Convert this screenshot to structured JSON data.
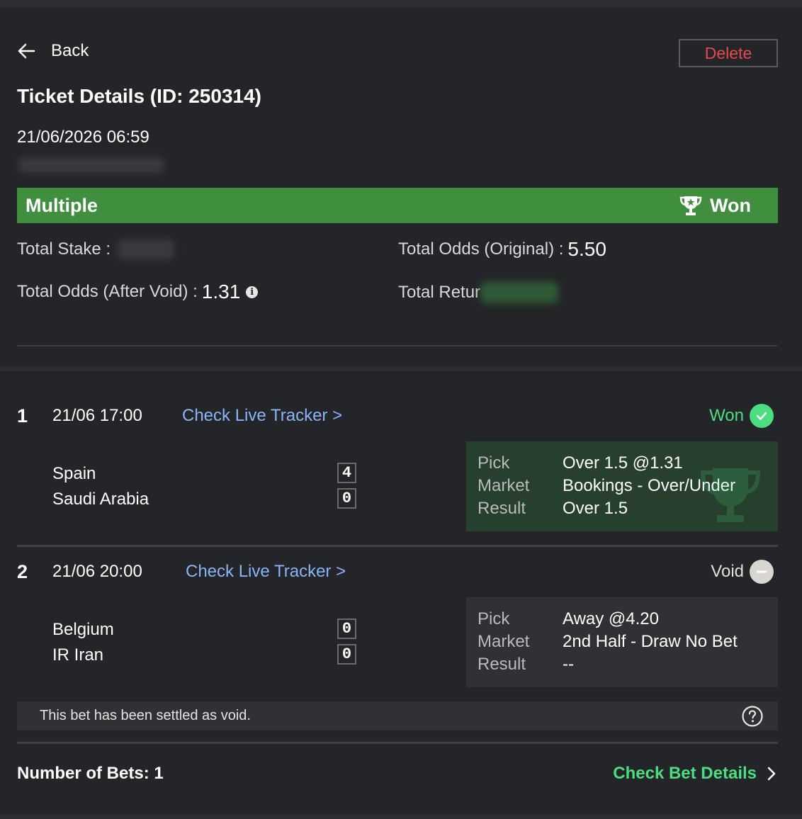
{
  "header": {
    "back_label": "Back",
    "delete_label": "Delete",
    "title": "Ticket Details (ID: 250314)",
    "datetime": "21/06/2026 06:59"
  },
  "status_bar": {
    "bet_type": "Multiple",
    "result": "Won",
    "color": "#3f8f3f"
  },
  "stats": {
    "total_stake_label": "Total Stake :",
    "total_odds_original_label": "Total Odds (Original) :",
    "total_odds_original_value": "5.50",
    "total_odds_after_void_label": "Total Odds (After Void) :",
    "total_odds_after_void_value": "1.31",
    "total_return_label": "Total Retur"
  },
  "legs": [
    {
      "number": "1",
      "time": "21/06 17:00",
      "tracker_label": "Check Live Tracker >",
      "status": "Won",
      "status_color": "#4ade80",
      "home": "Spain",
      "away": "Saudi Arabia",
      "home_score": "4",
      "away_score": "0",
      "pick_label": "Pick",
      "pick": "Over 1.5 @1.31",
      "market_label": "Market",
      "market": "Bookings - Over/Under",
      "result_label": "Result",
      "result": "Over 1.5"
    },
    {
      "number": "2",
      "time": "21/06 20:00",
      "tracker_label": "Check Live Tracker >",
      "status": "Void",
      "status_color": "#e0e0e0",
      "home": "Belgium",
      "away": "IR Iran",
      "home_score": "0",
      "away_score": "0",
      "pick_label": "Pick",
      "pick": "Away @4.20",
      "market_label": "Market",
      "market": "2nd Half - Draw No Bet",
      "result_label": "Result",
      "result": "--",
      "note": "This bet has been settled as void."
    }
  ],
  "footer": {
    "number_of_bets": "Number of Bets: 1",
    "check_details_label": "Check Bet Details"
  }
}
